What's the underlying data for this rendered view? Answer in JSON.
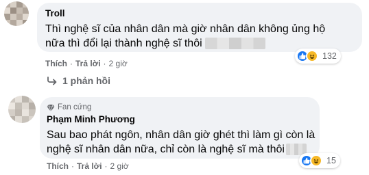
{
  "comments": [
    {
      "author": "Troll",
      "text_lines": [
        "Thì nghệ sĩ của nhân dân mà giờ nhân dân không ủng hộ",
        "nữa thì đổi lại thành nghệ sĩ thôi"
      ],
      "reaction_count": "132",
      "actions": {
        "like": "Thích",
        "reply": "Trả lời",
        "time": "2 giờ"
      },
      "replies_label": "1 phản hồi"
    },
    {
      "badge": "Fan cứng",
      "author": "Phạm Minh Phương",
      "text_lines": [
        "Sau bao phát ngôn, nhân dân giờ ghét thì làm gì còn là",
        "nghệ sĩ nhân dân nữa, chỉ còn là nghệ sĩ mà thôi"
      ],
      "reaction_count": "15",
      "actions": {
        "like": "Thích",
        "reply": "Trả lời",
        "time": "2 giờ"
      }
    }
  ],
  "separator": "·",
  "icons": [
    "avatar-image",
    "like-reaction-icon",
    "haha-reaction-icon",
    "reply-arrow-icon",
    "fan-badge-icon"
  ],
  "colors": {
    "bubble": "#f0f2f5",
    "secondary_text": "#65676b",
    "like_blue": "#1877f2",
    "haha_yellow": "#f7b928"
  }
}
